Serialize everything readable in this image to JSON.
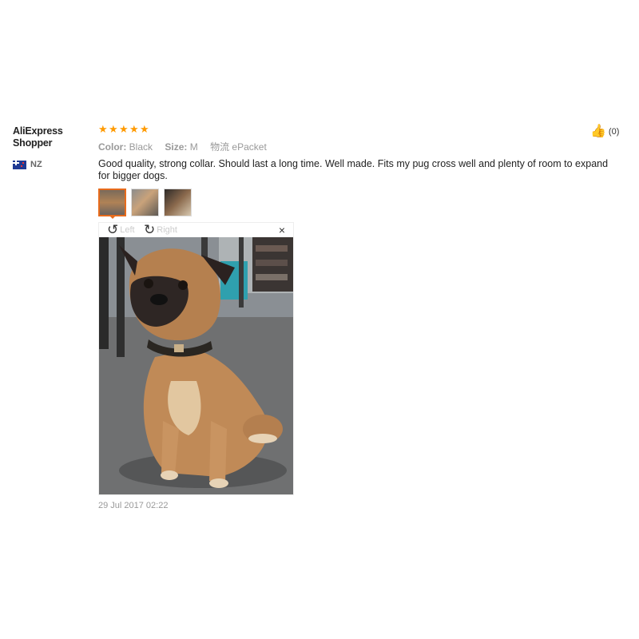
{
  "user": {
    "name_line1": "AliExpress",
    "name_line2": "Shopper",
    "country": "NZ"
  },
  "review": {
    "rating_stars": 5,
    "color_label": "Color:",
    "color_value": "Black",
    "size_label": "Size:",
    "size_value": "M",
    "shipping_label": "物流",
    "shipping_value": "ePacket",
    "text": "Good quality, strong collar. Should last a long time. Well made. Fits my pug cross well and plenty of room to expand for bigger dogs.",
    "date": "29 Jul 2017 02:22"
  },
  "helpful": {
    "count": "(0)"
  },
  "viewer": {
    "rotate_left_label": "Left",
    "rotate_right_label": "Right",
    "close_symbol": "×"
  },
  "colors": {
    "star": "#ff9a00",
    "accent": "#e76b1c"
  }
}
